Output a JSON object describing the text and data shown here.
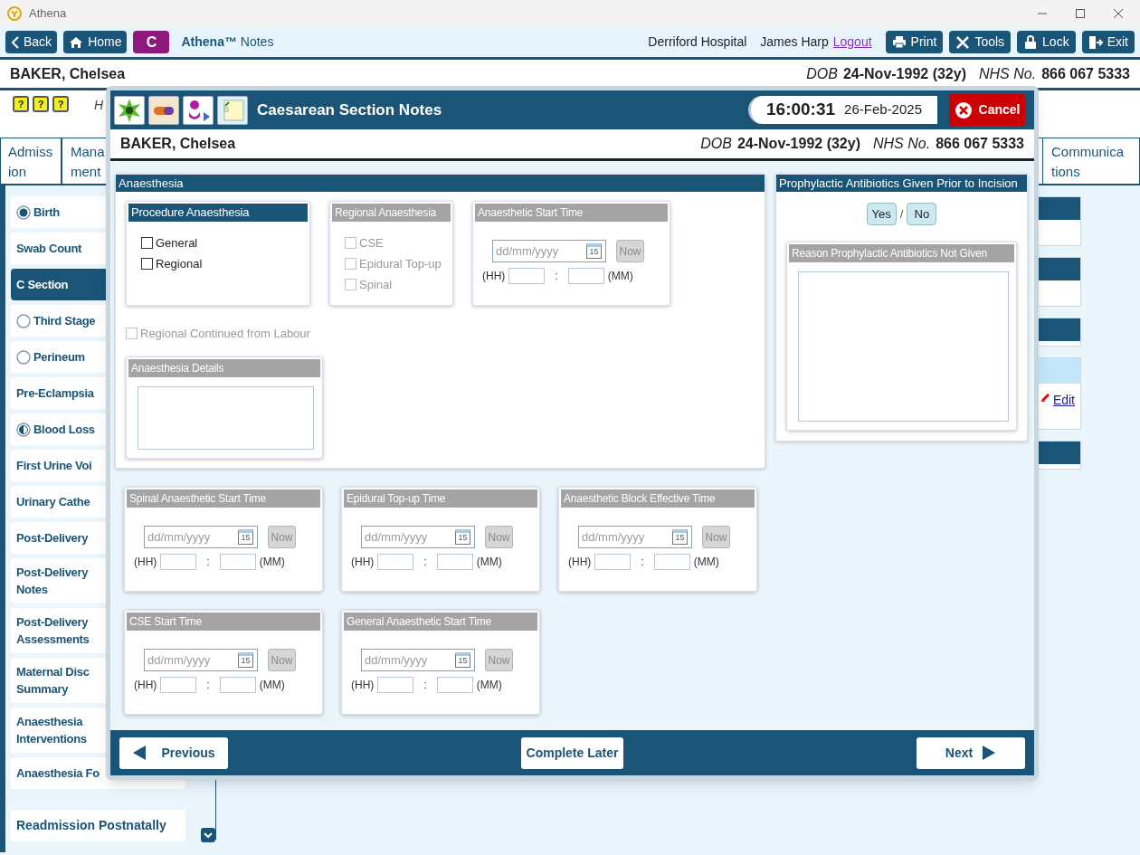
{
  "window": {
    "title": "Athena"
  },
  "toolbar": {
    "back": "Back",
    "home": "Home",
    "badge": "C",
    "app_name": "**Athena™** Notes",
    "hospital": "Derriford Hospital",
    "user": "James Harp",
    "logout": "Logout",
    "buttons": [
      {
        "label": "Print",
        "kind": "print"
      },
      {
        "label": "Tools",
        "kind": "tools"
      },
      {
        "label": "Lock",
        "kind": "lock"
      },
      {
        "label": "Exit",
        "kind": "exit"
      }
    ]
  },
  "patient": {
    "name": "BAKER, Chelsea",
    "dob_label": "DOB",
    "dob": "24-Nov-1992 (32y)",
    "nhs_label": "NHS No.",
    "nhs": "866 067 5333"
  },
  "alert_icons": [
    "?",
    "?",
    "?"
  ],
  "header_text": "H",
  "tabs": [
    {
      "lines": [
        "Admiss",
        "ion"
      ]
    },
    {
      "lines": [
        "Mana",
        "ment"
      ]
    },
    {
      "lines": [
        "Communica",
        "tions"
      ]
    }
  ],
  "sidebar": {
    "items": [
      {
        "label": "Birth",
        "kind": "complete",
        "selected": false
      },
      {
        "label": "Swab Count",
        "kind": "plain",
        "selected": false
      },
      {
        "label": "C Section",
        "kind": "plain",
        "selected": true
      },
      {
        "label": "Third Stage",
        "kind": "empty",
        "selected": false
      },
      {
        "label": "Perineum",
        "kind": "empty",
        "selected": false
      },
      {
        "label": "Pre-Eclampsia",
        "kind": "plain",
        "selected": false
      },
      {
        "label": "Blood Loss",
        "kind": "partial",
        "selected": false
      },
      {
        "label": "First Urine Voi",
        "kind": "plain",
        "selected": false
      },
      {
        "label": "Urinary Cathe",
        "kind": "plain",
        "selected": false
      },
      {
        "label": "Post-Delivery",
        "kind": "plain",
        "selected": false
      },
      {
        "label": "Post-Delivery\nNotes",
        "kind": "plain",
        "selected": false
      },
      {
        "label": "Post-Delivery\nAssessments",
        "kind": "plain",
        "selected": false
      },
      {
        "label": "Maternal Disc\nSummary",
        "kind": "plain",
        "selected": false
      },
      {
        "label": "Anaesthesia\nInterventions",
        "kind": "plain",
        "selected": false
      },
      {
        "label": "Anaesthesia Fo",
        "kind": "plain",
        "selected": false
      }
    ],
    "footer_item": "Readmission Postnatally"
  },
  "side_panels": [
    {
      "kind": "dark"
    },
    {
      "kind": "dark"
    },
    {
      "kind": "dark_short"
    },
    {
      "kind": "edit",
      "link": "Edit"
    },
    {
      "kind": "dark_short"
    }
  ],
  "modal": {
    "title": "Caesarean Section Notes",
    "time": "16:00:31",
    "date": "26-Feb-2025",
    "cancel": "Cancel",
    "patient": {
      "name": "BAKER, Chelsea",
      "dob_label": "DOB",
      "dob": "24-Nov-1992 (32y)",
      "nhs_label": "NHS No.",
      "nhs": "866 067 5333"
    },
    "anaesthesia": {
      "title": "Anaesthesia",
      "procedure": {
        "title": "Procedure Anaesthesia",
        "disabled": false,
        "options": [
          {
            "label": "General",
            "checked": false
          },
          {
            "label": "Regional",
            "checked": false
          }
        ]
      },
      "regional": {
        "title": "Regional Anaesthesia",
        "disabled": true,
        "options": [
          {
            "label": "CSE",
            "checked": false
          },
          {
            "label": "Epidural Top-up",
            "checked": false
          },
          {
            "label": "Spinal",
            "checked": false
          }
        ]
      },
      "start_time": {
        "title": "Anaesthetic Start Time",
        "disabled": true,
        "date_placeholder": "dd/mm/yyyy",
        "calendar": "15",
        "now": "Now",
        "hh": "(HH)",
        "sep": ":",
        "mm": "(MM)"
      },
      "continued": {
        "label": "Regional Continued from Labour",
        "checked": false,
        "disabled": true
      },
      "details": {
        "title": "Anaesthesia Details",
        "disabled": true
      }
    },
    "antibiotics": {
      "title": "Prophylactic Antibiotics Given Prior to Incision",
      "yes": "Yes",
      "separator": "/",
      "no": "No",
      "reason": {
        "title": "Reason Prophylactic Antibiotics Not Given",
        "disabled": true
      }
    },
    "time_groups": [
      {
        "title": "Spinal Anaesthetic Start Time",
        "disabled": true,
        "date_placeholder": "dd/mm/yyyy",
        "calendar": "15",
        "now": "Now",
        "hh": "(HH)",
        "sep": ":",
        "mm": "(MM)"
      },
      {
        "title": "Epidural Top-up Time",
        "disabled": true,
        "date_placeholder": "dd/mm/yyyy",
        "calendar": "15",
        "now": "Now",
        "hh": "(HH)",
        "sep": ":",
        "mm": "(MM)"
      },
      {
        "title": "Anaesthetic Block Effective Time",
        "disabled": true,
        "date_placeholder": "dd/mm/yyyy",
        "calendar": "15",
        "now": "Now",
        "hh": "(HH)",
        "sep": ":",
        "mm": "(MM)"
      },
      {
        "title": "CSE Start Time",
        "disabled": true,
        "date_placeholder": "dd/mm/yyyy",
        "calendar": "15",
        "now": "Now",
        "hh": "(HH)",
        "sep": ":",
        "mm": "(MM)"
      },
      {
        "title": "General Anaesthetic Start Time",
        "disabled": true,
        "date_placeholder": "dd/mm/yyyy",
        "calendar": "15",
        "now": "Now",
        "hh": "(HH)",
        "sep": ":",
        "mm": "(MM)"
      }
    ],
    "footer": {
      "previous": "Previous",
      "complete_later": "Complete Later",
      "next": "Next"
    }
  }
}
